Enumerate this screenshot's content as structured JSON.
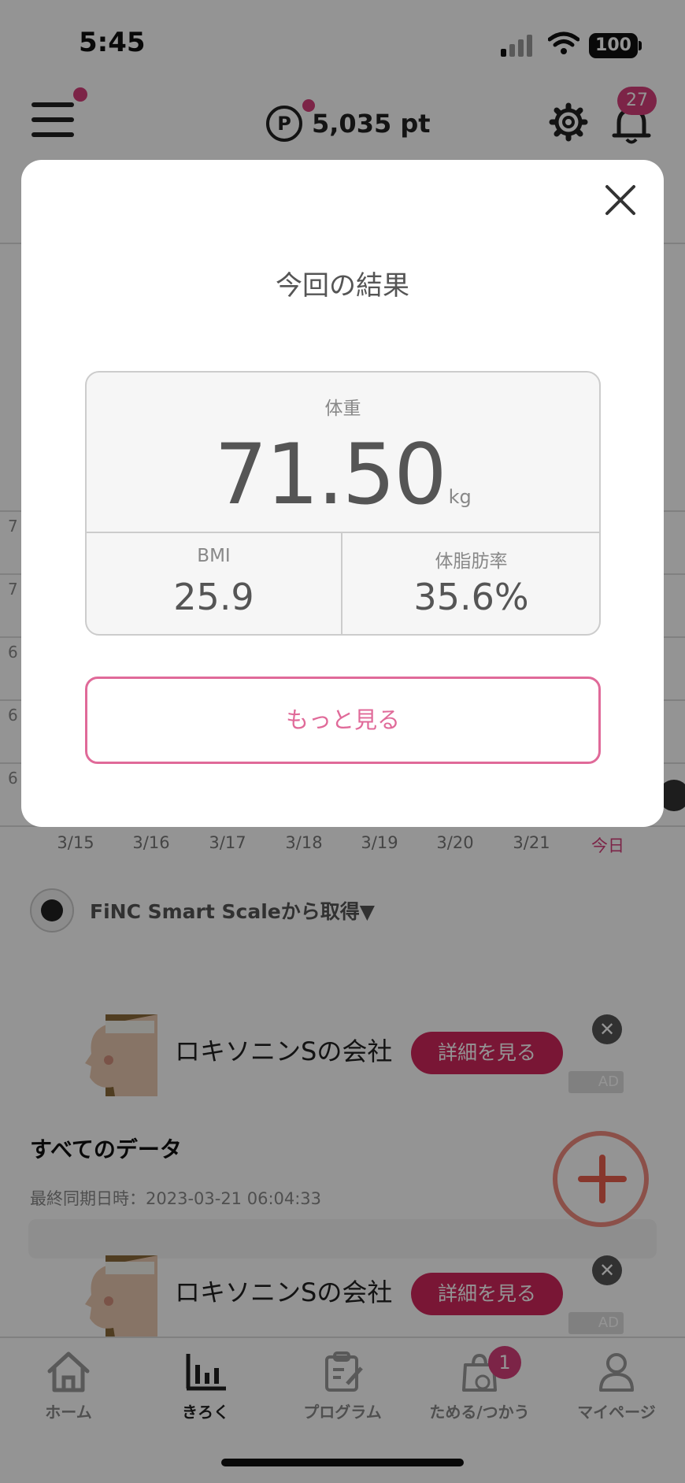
{
  "status_bar": {
    "time": "5:45",
    "battery": "100"
  },
  "header": {
    "points": "5,035 pt",
    "points_icon_letter": "P",
    "notification_count": "27"
  },
  "chart": {
    "y_ticks": [
      "7",
      "7",
      "6",
      "6",
      "6"
    ],
    "x_labels": [
      "3/15",
      "3/16",
      "3/17",
      "3/18",
      "3/19",
      "3/20",
      "3/21",
      "今日"
    ]
  },
  "source": {
    "label": "FiNC Smart Scaleから取得▼"
  },
  "ads": [
    {
      "title": "ロキソニンSの会社",
      "cta": "詳細を見る",
      "mark": "AD",
      "close": "✕"
    },
    {
      "title": "ロキソニンSの会社",
      "cta": "詳細を見る",
      "mark": "AD",
      "close": "✕"
    }
  ],
  "all_data": {
    "title": "すべてのデータ",
    "sync": "最終同期日時：2023-03-21 06:04:33"
  },
  "tabs": [
    {
      "label": "ホーム",
      "icon": "home-icon"
    },
    {
      "label": "きろく",
      "icon": "chart-icon",
      "active": true
    },
    {
      "label": "プログラム",
      "icon": "clipboard-icon"
    },
    {
      "label": "ためる/つかう",
      "icon": "shopping-bag-icon",
      "badge": "1"
    },
    {
      "label": "マイページ",
      "icon": "person-icon"
    }
  ],
  "modal": {
    "title": "今回の結果",
    "weight": {
      "label": "体重",
      "value": "71.50",
      "unit": "kg"
    },
    "bmi": {
      "label": "BMI",
      "value": "25.9"
    },
    "body_fat": {
      "label": "体脂肪率",
      "value": "35.6%"
    },
    "more_button": "もっと見る"
  },
  "colors": {
    "accent": "#d63f7a",
    "cta": "#d1265c",
    "fab": "#e8604f"
  }
}
